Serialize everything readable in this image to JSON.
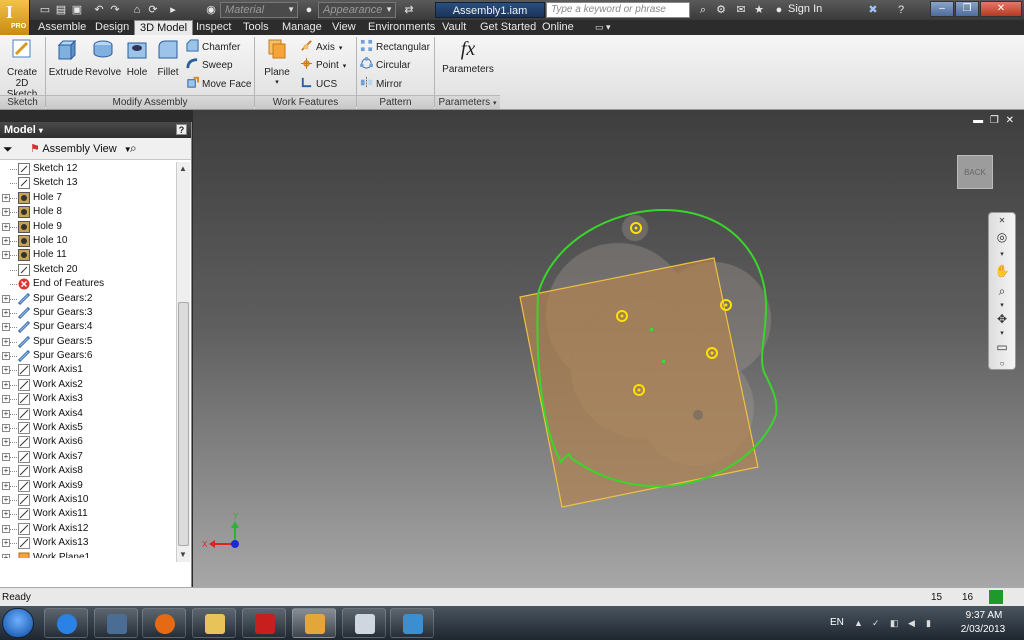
{
  "titlebar": {
    "material": "Material",
    "appearance": "Appearance",
    "document_title": "Assembly1.iam",
    "search_placeholder": "Type a keyword or phrase",
    "signin": "Sign In",
    "app_logo": "I",
    "app_edition": "PRO"
  },
  "tabs": [
    "Assemble",
    "Design",
    "3D Model",
    "Inspect",
    "Tools",
    "Manage",
    "View",
    "Environments",
    "Vault",
    "Get Started",
    "Online"
  ],
  "active_tab": "3D Model",
  "ribbon": {
    "create_sketch": "Create 2D Sketch",
    "extrude": "Extrude",
    "revolve": "Revolve",
    "hole": "Hole",
    "fillet": "Fillet",
    "chamfer": "Chamfer",
    "sweep": "Sweep",
    "move_face": "Move Face",
    "plane": "Plane",
    "axis": "Axis",
    "point": "Point",
    "ucs": "UCS",
    "rectangular": "Rectangular",
    "circular": "Circular",
    "mirror": "Mirror",
    "parameters_symbol": "fx",
    "parameters": "Parameters",
    "groups": {
      "sketch": "Sketch",
      "modify": "Modify Assembly",
      "work": "Work Features",
      "pattern": "Pattern",
      "params": "Parameters"
    }
  },
  "browser": {
    "title": "Model",
    "view": "Assembly View",
    "items": [
      {
        "label": "Sketch 12",
        "icon": "sketch-icon",
        "expandable": false
      },
      {
        "label": "Sketch 13",
        "icon": "sketch-icon",
        "expandable": false
      },
      {
        "label": "Hole 7",
        "icon": "hole-icon",
        "expandable": true
      },
      {
        "label": "Hole 8",
        "icon": "hole-icon",
        "expandable": true
      },
      {
        "label": "Hole 9",
        "icon": "hole-icon",
        "expandable": true
      },
      {
        "label": "Hole 10",
        "icon": "hole-icon",
        "expandable": true
      },
      {
        "label": "Hole 11",
        "icon": "hole-icon",
        "expandable": true
      },
      {
        "label": "Sketch 20",
        "icon": "sketch-icon",
        "expandable": false
      },
      {
        "label": "End of Features",
        "icon": "end-of-features-icon",
        "expandable": false
      },
      {
        "label": "Spur Gears:2",
        "icon": "spur-gear-icon",
        "expandable": true
      },
      {
        "label": "Spur Gears:3",
        "icon": "spur-gear-icon",
        "expandable": true
      },
      {
        "label": "Spur Gears:4",
        "icon": "spur-gear-icon",
        "expandable": true
      },
      {
        "label": "Spur Gears:5",
        "icon": "spur-gear-icon",
        "expandable": true
      },
      {
        "label": "Spur Gears:6",
        "icon": "spur-gear-icon",
        "expandable": true
      },
      {
        "label": "Work Axis1",
        "icon": "work-axis-icon",
        "expandable": true
      },
      {
        "label": "Work Axis2",
        "icon": "work-axis-icon",
        "expandable": true
      },
      {
        "label": "Work Axis3",
        "icon": "work-axis-icon",
        "expandable": true
      },
      {
        "label": "Work Axis4",
        "icon": "work-axis-icon",
        "expandable": true
      },
      {
        "label": "Work Axis5",
        "icon": "work-axis-icon",
        "expandable": true
      },
      {
        "label": "Work Axis6",
        "icon": "work-axis-icon",
        "expandable": true
      },
      {
        "label": "Work Axis7",
        "icon": "work-axis-icon",
        "expandable": true
      },
      {
        "label": "Work Axis8",
        "icon": "work-axis-icon",
        "expandable": true
      },
      {
        "label": "Work Axis9",
        "icon": "work-axis-icon",
        "expandable": true
      },
      {
        "label": "Work Axis10",
        "icon": "work-axis-icon",
        "expandable": true
      },
      {
        "label": "Work Axis11",
        "icon": "work-axis-icon",
        "expandable": true
      },
      {
        "label": "Work Axis12",
        "icon": "work-axis-icon",
        "expandable": true
      },
      {
        "label": "Work Axis13",
        "icon": "work-axis-icon",
        "expandable": true
      },
      {
        "label": "Work Plane1",
        "icon": "work-plane-icon",
        "expandable": true
      }
    ]
  },
  "viewport": {
    "viewcube_label": "BACK",
    "triad": {
      "x": "X",
      "y": "Y"
    }
  },
  "status": {
    "text": "Ready",
    "value_a": "15",
    "value_b": "16"
  },
  "taskbar": {
    "lang": "EN",
    "time": "9:37 AM",
    "date": "2/03/2013"
  },
  "colors": {
    "accent": "#2a4f80",
    "sketch_profile": "#3ddc2a",
    "work_plane": "#e6b43a",
    "axis_marker": "#ffe100"
  }
}
